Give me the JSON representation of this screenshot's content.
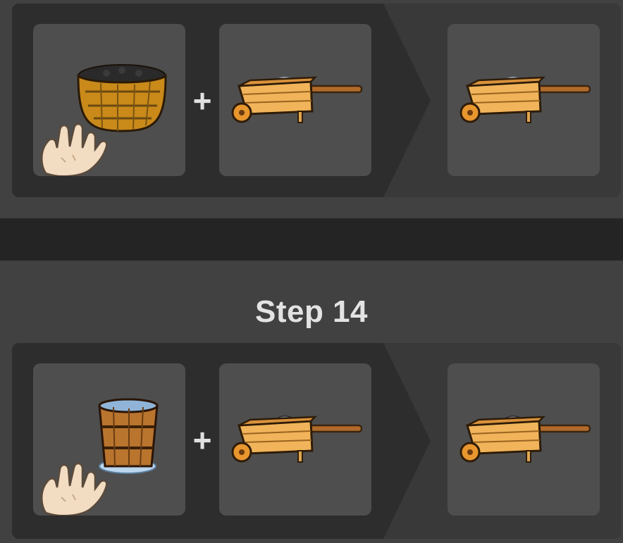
{
  "steps": [
    {
      "title": "",
      "ingredients": [
        {
          "icon": "basket-of-coal-with-hand-icon"
        },
        {
          "icon": "wheelbarrow-with-stones-icon"
        }
      ],
      "plus_symbol": "+",
      "result": {
        "icon": "wheelbarrow-with-stones-icon"
      }
    },
    {
      "title": "Step 14",
      "ingredients": [
        {
          "icon": "water-bucket-with-hand-icon"
        },
        {
          "icon": "wheelbarrow-with-coal-icon"
        }
      ],
      "plus_symbol": "+",
      "result": {
        "icon": "wheelbarrow-with-coal-icon"
      }
    }
  ],
  "colors": {
    "background": "#414141",
    "panel": "#313131",
    "slot": "#4e4e4e",
    "separator": "#242424",
    "text": "#e3e3e3"
  }
}
